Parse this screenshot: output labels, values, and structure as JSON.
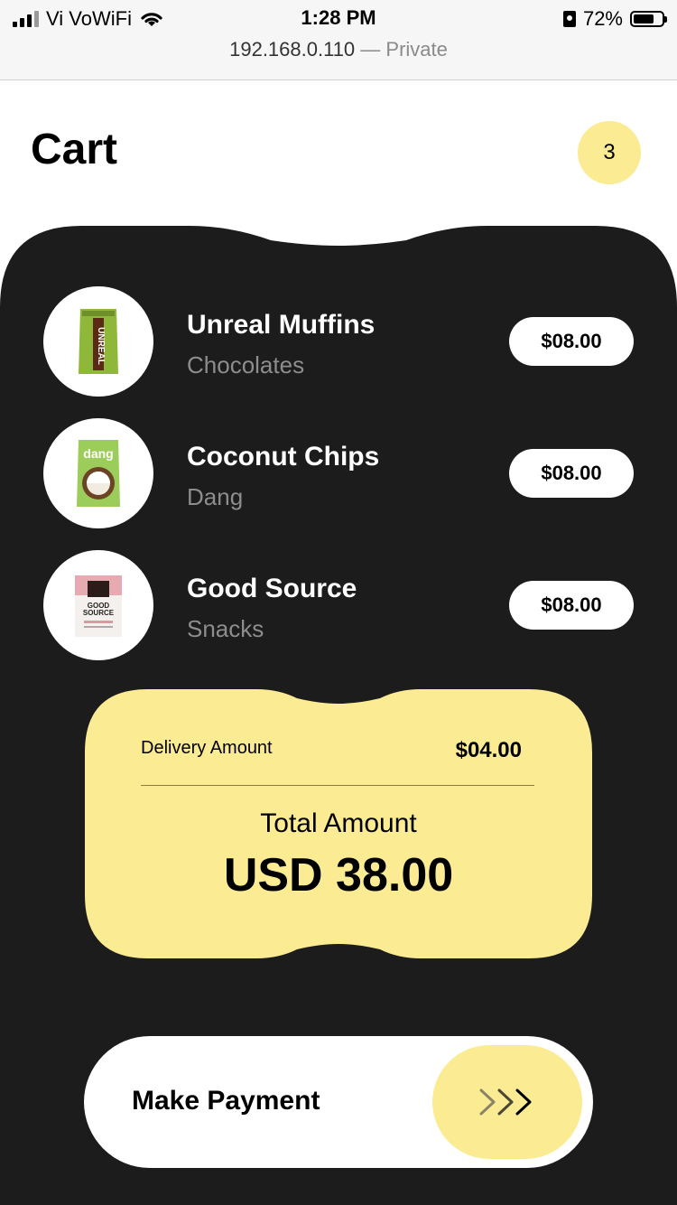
{
  "status_bar": {
    "carrier": "Vi VoWiFi",
    "time": "1:28 PM",
    "battery": "72%",
    "battery_level": 0.72,
    "url": "192.168.0.110",
    "url_suffix": "— Private"
  },
  "header": {
    "title": "Cart",
    "count": "3"
  },
  "cart": {
    "items": [
      {
        "name": "Unreal Muffins",
        "category": "Chocolates",
        "price": "$08.00",
        "thumb_icon": "unreal-bag-icon"
      },
      {
        "name": "Coconut Chips",
        "category": "Dang",
        "price": "$08.00",
        "thumb_icon": "dang-bag-icon"
      },
      {
        "name": "Good Source",
        "category": "Snacks",
        "price": "$08.00",
        "thumb_icon": "good-source-bag-icon"
      }
    ]
  },
  "summary": {
    "delivery_label": "Delivery Amount",
    "delivery_value": "$04.00",
    "total_label": "Total Amount",
    "total_value": "USD 38.00"
  },
  "payment": {
    "label": "Make Payment",
    "icon": "triple-chevron-right-icon"
  },
  "colors": {
    "panel": "#1c1c1c",
    "accent": "#fbeb92",
    "muted": "#8d8d8d"
  }
}
